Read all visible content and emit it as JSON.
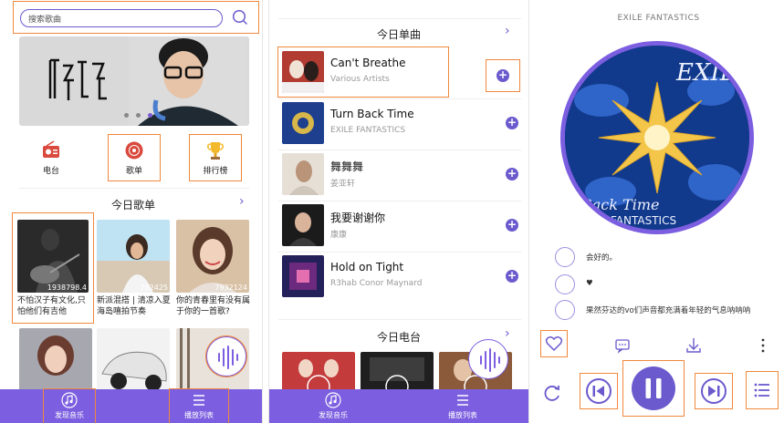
{
  "panel1": {
    "search": {
      "placeholder": "搜索歌曲"
    },
    "quick": [
      {
        "label": "电台",
        "icon": "radio-icon"
      },
      {
        "label": "歌单",
        "icon": "disc-icon"
      },
      {
        "label": "排行榜",
        "icon": "trophy-icon"
      }
    ],
    "section_title": "今日歌单",
    "playlists": [
      {
        "count": "1938798.4",
        "caption": "不怕汉子有文化,只怕他们有吉他"
      },
      {
        "count": "782425",
        "caption": "新派混搭 | 清凉入夏 海岛嘻拍节奏"
      },
      {
        "count": "7932124",
        "caption": "你的青春里有没有属于你的一首歌?"
      }
    ],
    "tabs": [
      {
        "label": "发现音乐",
        "icon": "music-note-icon"
      },
      {
        "label": "播放列表",
        "icon": "list-icon"
      }
    ]
  },
  "panel2": {
    "section_title": "今日单曲",
    "songs": [
      {
        "name": "Can't Breathe",
        "artist": "Various Artists"
      },
      {
        "name": "Turn Back Time",
        "artist": "EXILE  FANTASTICS"
      },
      {
        "name": "舞舞舞",
        "artist": "姜亚轩"
      },
      {
        "name": "我要谢谢你",
        "artist": "康康"
      },
      {
        "name": "Hold on Tight",
        "artist": "R3hab  Conor Maynard"
      }
    ],
    "radio_title": "今日电台",
    "tabs": [
      {
        "label": "发现音乐",
        "icon": "music-note-icon"
      },
      {
        "label": "播放列表",
        "icon": "list-icon"
      }
    ]
  },
  "panel3": {
    "artist": "EXILE  FANTASTICS",
    "comments": [
      {
        "text": "会好的。"
      },
      {
        "text": "♥"
      },
      {
        "text": "果然芬达的vo们声音都充满着年轻的气息呐呐呐"
      }
    ],
    "actions": [
      "heart-icon",
      "comment-icon",
      "download-icon",
      "more-icon"
    ],
    "controls": [
      "repeat-icon",
      "previous-icon",
      "pause-icon",
      "next-icon",
      "playlist-icon"
    ]
  },
  "colors": {
    "accent": "#7c5ee0",
    "highlight": "#f0883c"
  }
}
